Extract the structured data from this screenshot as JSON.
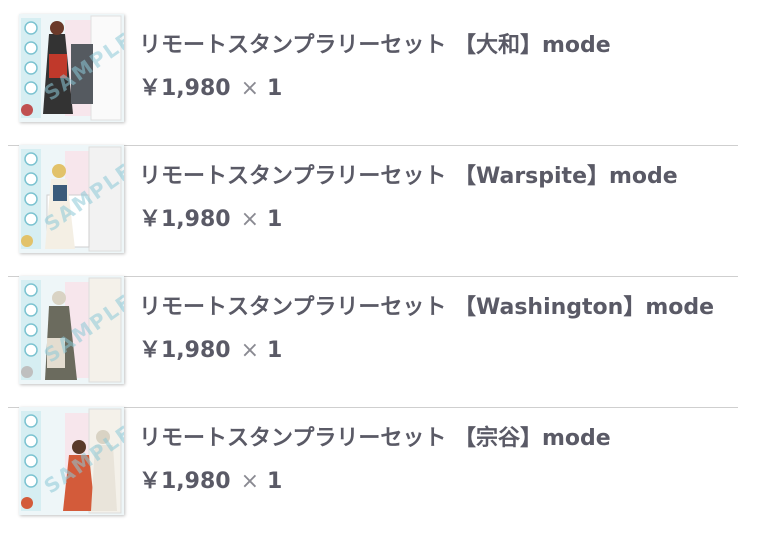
{
  "cart": {
    "items": [
      {
        "title": "リモートスタンプラリーセット 【大和】mode",
        "price": "￥1,980",
        "times": "×",
        "quantity": "1",
        "sample_text": "SAMPLE",
        "accent": "#c0392b"
      },
      {
        "title": "リモートスタンプラリーセット 【Warspite】mode",
        "price": "￥1,980",
        "times": "×",
        "quantity": "1",
        "sample_text": "SAMPLE",
        "accent": "#3b5b7a"
      },
      {
        "title": "リモートスタンプラリーセット 【Washington】mode",
        "price": "￥1,980",
        "times": "×",
        "quantity": "1",
        "sample_text": "SAMPLE",
        "accent": "#6b6b5e"
      },
      {
        "title": "リモートスタンプラリーセット 【宗谷】mode",
        "price": "￥1,980",
        "times": "×",
        "quantity": "1",
        "sample_text": "SAMPLE",
        "accent": "#d35b3a"
      }
    ]
  }
}
